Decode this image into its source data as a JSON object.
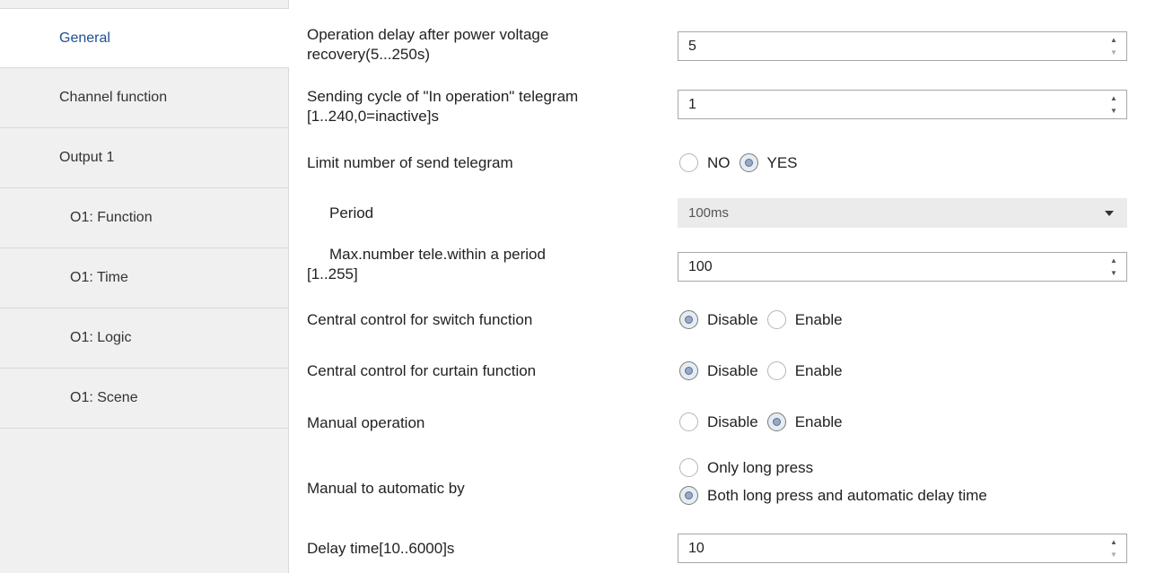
{
  "sidebar": {
    "items": [
      {
        "label": "General"
      },
      {
        "label": "Channel function"
      },
      {
        "label": "Output 1"
      },
      {
        "label": "O1: Function"
      },
      {
        "label": "O1: Time"
      },
      {
        "label": "O1: Logic"
      },
      {
        "label": "O1: Scene"
      }
    ]
  },
  "params": {
    "op_delay": {
      "label_line1": "Operation delay after power voltage",
      "label_line2": "recovery(5...250s)",
      "value": "5"
    },
    "send_cycle": {
      "label_line1": "Sending cycle of \"In operation\" telegram",
      "label_line2": "[1..240,0=inactive]s",
      "value": "1"
    },
    "limit_send": {
      "label": "Limit number of send telegram",
      "opt_no": "NO",
      "opt_yes": "YES",
      "selected": "YES"
    },
    "period": {
      "label": "Period",
      "value": "100ms"
    },
    "max_number": {
      "label_line1": "Max.number tele.within a period",
      "label_line2": "[1..255]",
      "value": "100"
    },
    "central_switch": {
      "label": "Central control for switch function",
      "opt_disable": "Disable",
      "opt_enable": "Enable",
      "selected": "Disable"
    },
    "central_curtain": {
      "label": "Central control for curtain function",
      "opt_disable": "Disable",
      "opt_enable": "Enable",
      "selected": "Disable"
    },
    "manual_op": {
      "label": "Manual operation",
      "opt_disable": "Disable",
      "opt_enable": "Enable",
      "selected": "Enable"
    },
    "manual_to_auto": {
      "label": "Manual to automatic by",
      "opt_long": "Only long press",
      "opt_both": "Both long press and automatic delay time",
      "selected": "Both long press and automatic delay time"
    },
    "delay_time": {
      "label": "Delay time[10..6000]s",
      "value": "10"
    }
  },
  "colors": {
    "active_nav": "#1f4f8f",
    "sidebar_bg": "#f0f0f0"
  }
}
